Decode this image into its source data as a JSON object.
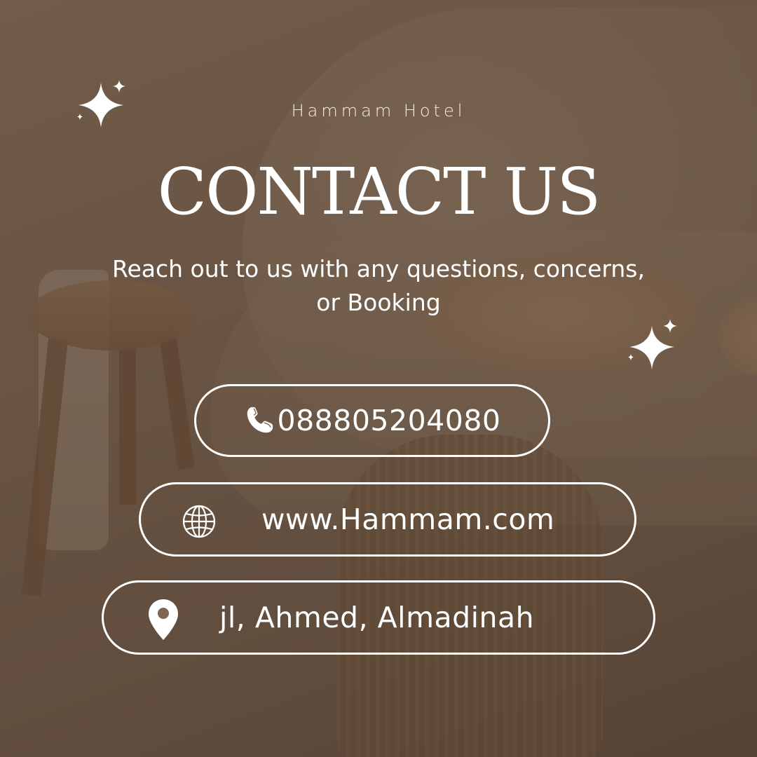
{
  "brand": "Hammam Hotel",
  "title": "CONTACT US",
  "subtitle": "Reach out to us with any questions, concerns, or Booking",
  "contacts": {
    "phone": {
      "icon": "phone-icon",
      "value": "088805204080"
    },
    "website": {
      "icon": "globe-icon",
      "value": "www.Hammam.com"
    },
    "address": {
      "icon": "location-pin-icon",
      "value": "jl, Ahmed, Almadinah"
    }
  },
  "colors": {
    "text": "#ffffff",
    "overlay": "#7d6654"
  }
}
